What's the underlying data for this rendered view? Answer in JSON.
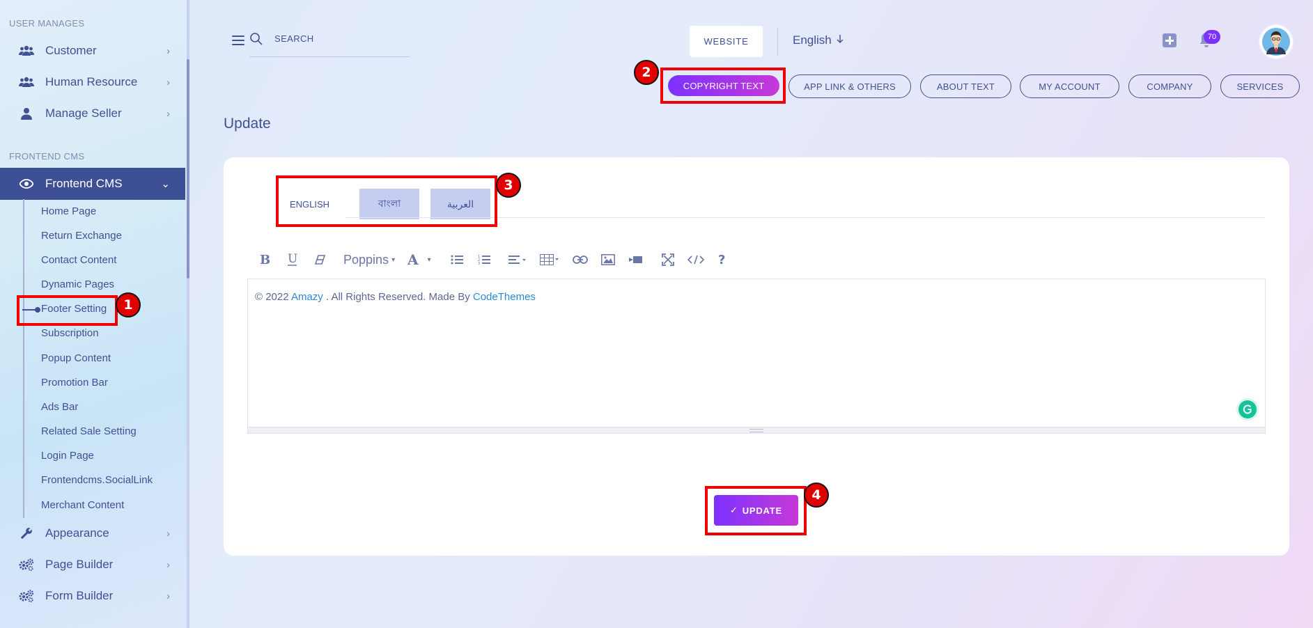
{
  "sidebar": {
    "section_user": "USER MANAGES",
    "section_cms": "FRONTEND CMS",
    "items_top": [
      {
        "label": "Customer",
        "icon": "users-icon"
      },
      {
        "label": "Human Resource",
        "icon": "users-icon"
      },
      {
        "label": "Manage Seller",
        "icon": "user-icon"
      }
    ],
    "active_item": {
      "label": "Frontend CMS",
      "icon": "eye-icon"
    },
    "sub_items": [
      "Home Page",
      "Return Exchange",
      "Contact Content",
      "Dynamic Pages",
      "Footer Setting",
      "Subscription",
      "Popup Content",
      "Promotion Bar",
      "Ads Bar",
      "Related Sale Setting",
      "Login Page",
      "Frontendcms.SocialLink",
      "Merchant Content"
    ],
    "items_bottom": [
      {
        "label": "Appearance",
        "icon": "wrench-icon"
      },
      {
        "label": "Page Builder",
        "icon": "gears-icon"
      },
      {
        "label": "Form Builder",
        "icon": "gears-icon"
      }
    ]
  },
  "header": {
    "search_placeholder": "SEARCH",
    "website_label": "WEBSITE",
    "language": "English",
    "notification_count": "70"
  },
  "tabs": [
    "COPYRIGHT TEXT",
    "APP LINK & OTHERS",
    "ABOUT TEXT",
    "MY ACCOUNT",
    "COMPANY",
    "SERVICES"
  ],
  "page_title": "Update",
  "lang_tabs": [
    "ENGLISH",
    "বাংলা",
    "العربية"
  ],
  "editor": {
    "font_name": "Poppins",
    "content_prefix": "© 2022 ",
    "content_link1": "Amazy",
    "content_middle": " . All Rights Reserved. Made By ",
    "content_link2": "CodeThemes"
  },
  "update_button": "UPDATE",
  "annotations": [
    "1",
    "2",
    "3",
    "4"
  ],
  "colors": {
    "accent_purple": "#7c32ff",
    "accent_pink": "#c738d8",
    "primary_text": "#415094",
    "sidebar_active": "#3e5095",
    "annotation_red": "#f20000"
  }
}
